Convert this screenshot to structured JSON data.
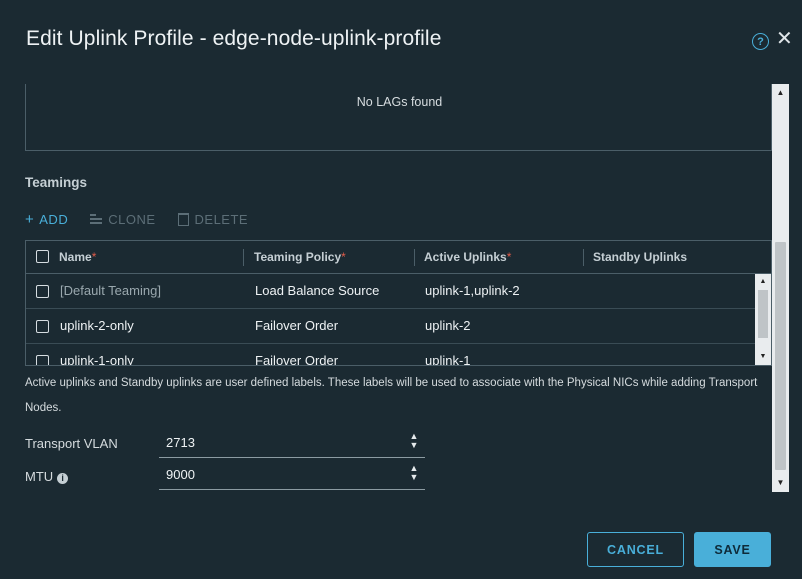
{
  "dialog": {
    "title": "Edit Uplink Profile - edge-node-uplink-profile",
    "help_glyph": "?",
    "close_glyph": "✕"
  },
  "lags": {
    "empty_text": "No LAGs found"
  },
  "teamings": {
    "section_title": "Teamings",
    "toolbar": {
      "add_label": "ADD",
      "clone_label": "CLONE",
      "delete_label": "DELETE"
    },
    "columns": {
      "name": "Name",
      "policy": "Teaming Policy",
      "active": "Active Uplinks",
      "standby": "Standby Uplinks",
      "required_mark": "*"
    },
    "rows": [
      {
        "name": "[Default Teaming]",
        "policy": "Load Balance Source",
        "active": "uplink-1,uplink-2",
        "standby": ""
      },
      {
        "name": "uplink-2-only",
        "policy": "Failover Order",
        "active": "uplink-2",
        "standby": ""
      },
      {
        "name": "uplink-1-only",
        "policy": "Failover Order",
        "active": "uplink-1",
        "standby": ""
      }
    ],
    "help_text": "Active uplinks and Standby uplinks are user defined labels. These labels will be used to associate with the Physical NICs while adding Transport Nodes."
  },
  "fields": {
    "transport_vlan": {
      "label": "Transport VLAN",
      "value": "2713"
    },
    "mtu": {
      "label": "MTU",
      "value": "9000"
    }
  },
  "footer": {
    "cancel_label": "CANCEL",
    "save_label": "SAVE"
  },
  "colors": {
    "background": "#1b2a32",
    "accent": "#49afd9",
    "required": "#e25c4a"
  }
}
